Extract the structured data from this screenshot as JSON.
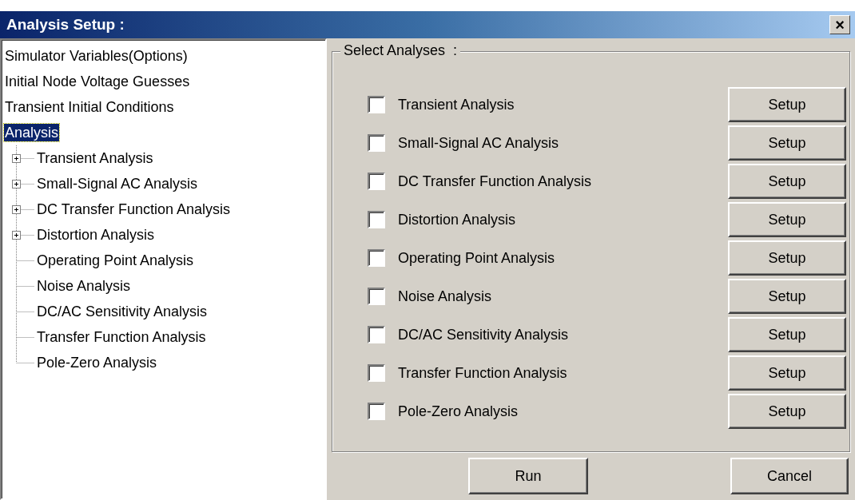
{
  "window": {
    "title": "Analysis Setup :",
    "close": "×"
  },
  "tree": [
    {
      "label": "Simulator Variables(Options)",
      "selected": false
    },
    {
      "label": "Initial Node Voltage Guesses",
      "selected": false
    },
    {
      "label": "Transient Initial Conditions",
      "selected": false
    },
    {
      "label": "Analysis",
      "selected": true,
      "children": [
        {
          "label": "Transient Analysis",
          "kind": "expandable"
        },
        {
          "label": "Small-Signal AC Analysis",
          "kind": "expandable"
        },
        {
          "label": "DC Transfer Function Analysis",
          "kind": "expandable"
        },
        {
          "label": "Distortion Analysis",
          "kind": "expandable"
        },
        {
          "label": "Operating Point Analysis",
          "kind": "leaf"
        },
        {
          "label": "Noise Analysis",
          "kind": "leaf"
        },
        {
          "label": "DC/AC Sensitivity Analysis",
          "kind": "leaf"
        },
        {
          "label": "Transfer Function Analysis",
          "kind": "leaf"
        },
        {
          "label": "Pole-Zero Analysis",
          "kind": "leaf"
        }
      ]
    }
  ],
  "group": {
    "title": "Select Analyses  :",
    "analyses": [
      {
        "label": "Transient Analysis",
        "checked": false,
        "button": "Setup"
      },
      {
        "label": "Small-Signal AC Analysis",
        "checked": false,
        "button": "Setup"
      },
      {
        "label": "DC Transfer Function Analysis",
        "checked": false,
        "button": "Setup"
      },
      {
        "label": "Distortion Analysis",
        "checked": false,
        "button": "Setup"
      },
      {
        "label": "Operating Point Analysis",
        "checked": false,
        "button": "Setup"
      },
      {
        "label": "Noise Analysis",
        "checked": false,
        "button": "Setup"
      },
      {
        "label": "DC/AC Sensitivity Analysis",
        "checked": false,
        "button": "Setup"
      },
      {
        "label": "Transfer Function Analysis",
        "checked": false,
        "button": "Setup"
      },
      {
        "label": "Pole-Zero Analysis",
        "checked": false,
        "button": "Setup"
      }
    ]
  },
  "buttons": [
    "Run",
    "Cancel"
  ]
}
